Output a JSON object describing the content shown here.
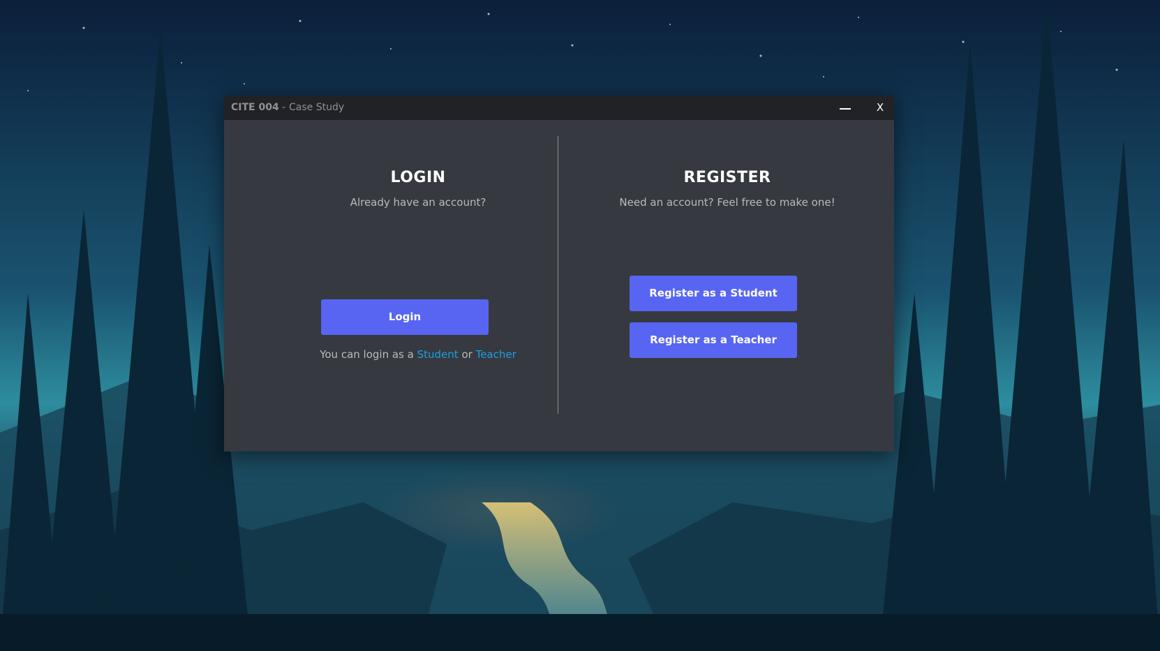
{
  "window": {
    "title_bold": "CITE 004",
    "title_separator": "-",
    "title_rest": "Case Study",
    "minimize_label": "—",
    "close_label": "X"
  },
  "login": {
    "heading": "LOGIN",
    "subtitle": "Already have an account?",
    "button_label": "Login",
    "hint_prefix": "You can login as a",
    "student_link": "Student",
    "or_text": "or",
    "teacher_link": "Teacher"
  },
  "register": {
    "heading": "REGISTER",
    "subtitle": "Need an account? Feel free to make one!",
    "student_button_label": "Register as a Student",
    "teacher_button_label": "Register as a Teacher"
  },
  "colors": {
    "window_bg": "#36393f",
    "titlebar_bg": "#202225",
    "button_accent": "#5865f2",
    "link": "#1ea0e0"
  }
}
